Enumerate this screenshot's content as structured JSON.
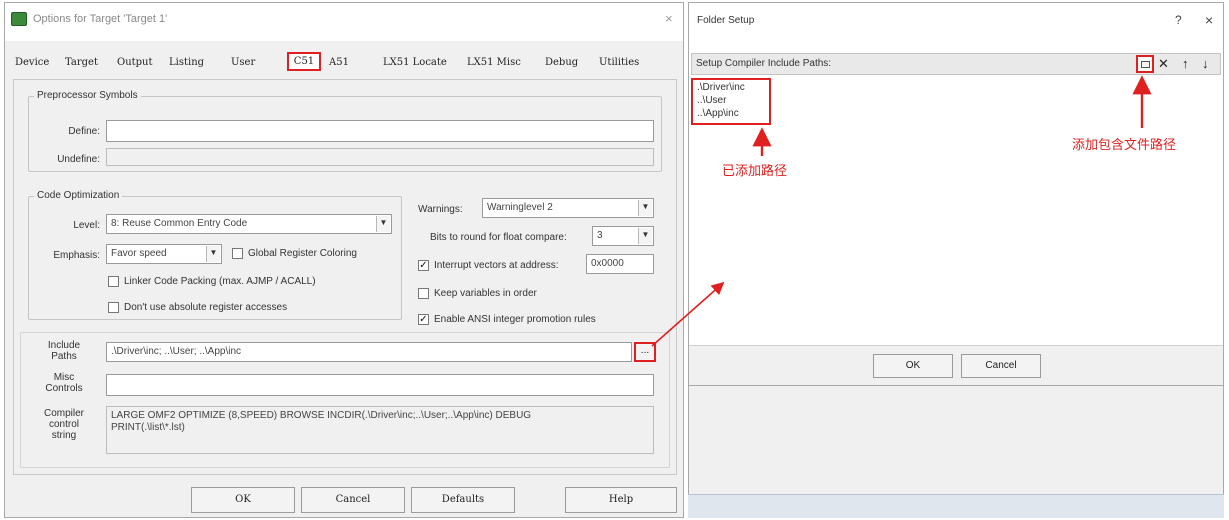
{
  "left_dialog": {
    "title": "Options for Target 'Target 1'",
    "close_glyph": "×",
    "tabs": [
      "Device",
      "Target",
      "Output",
      "Listing",
      "User",
      "C51",
      "A51",
      "LX51 Locate",
      "LX51 Misc",
      "Debug",
      "Utilities"
    ],
    "active_tab": "C51",
    "preprocessor": {
      "legend": "Preprocessor Symbols",
      "define_label": "Define:",
      "define_value": "",
      "undefine_label": "Undefine:",
      "undefine_value": ""
    },
    "code_optimization": {
      "legend": "Code Optimization",
      "level_label": "Level:",
      "level_value": "8: Reuse Common Entry Code",
      "emphasis_label": "Emphasis:",
      "emphasis_value": "Favor speed",
      "global_register_coloring": {
        "label": "Global Register Coloring",
        "checked": false
      },
      "linker_code_packing": {
        "label": "Linker Code Packing (max. AJMP / ACALL)",
        "checked": false
      },
      "dont_use_absolute": {
        "label": "Don't use absolute register accesses",
        "checked": false
      }
    },
    "warnings": {
      "label": "Warnings:",
      "value": "Warninglevel 2",
      "bits_round_label": "Bits to round for float compare:",
      "bits_round_value": "3",
      "interrupt_vectors": {
        "label": "Interrupt vectors at address:",
        "checked": true,
        "address": "0x0000"
      },
      "keep_variables": {
        "label": "Keep variables in order",
        "checked": false
      },
      "enable_ansi": {
        "label": "Enable ANSI integer promotion rules",
        "checked": true
      }
    },
    "include_paths": {
      "label_line1": "Include",
      "label_line2": "Paths",
      "value": ".\\Driver\\inc; ..\\User; ..\\App\\inc",
      "browse_glyph": "..."
    },
    "misc_controls": {
      "label_line1": "Misc",
      "label_line2": "Controls",
      "value": ""
    },
    "compiler_control": {
      "label_line1": "Compiler",
      "label_line2": "control",
      "label_line3": "string",
      "line1": "LARGE OMF2 OPTIMIZE (8,SPEED) BROWSE INCDIR(.\\Driver\\inc;..\\User;..\\App\\inc) DEBUG",
      "line2": "PRINT(.\\list\\*.lst)"
    },
    "buttons": {
      "ok": "OK",
      "cancel": "Cancel",
      "defaults": "Defaults",
      "help": "Help"
    }
  },
  "right_dialog": {
    "title": "Folder Setup",
    "help_glyph": "?",
    "close_glyph": "×",
    "section_label": "Setup Compiler Include Paths:",
    "tool_glyphs": {
      "delete": "✕",
      "move_up": "↑",
      "move_down": "↓"
    },
    "paths": [
      ".\\Driver\\inc",
      "..\\User",
      "..\\App\\inc"
    ],
    "buttons": {
      "ok": "OK",
      "cancel": "Cancel"
    }
  },
  "annotations": {
    "added_paths": "已添加路径",
    "add_include_path": "添加包含文件路径"
  },
  "colors": {
    "annotation_red": "#e02020",
    "dialog_bg": "#f0f0f0"
  },
  "icons": [
    "app-icon",
    "new-folder-icon",
    "delete-icon",
    "move-up-icon",
    "move-down-icon",
    "combo-arrow-icon"
  ]
}
